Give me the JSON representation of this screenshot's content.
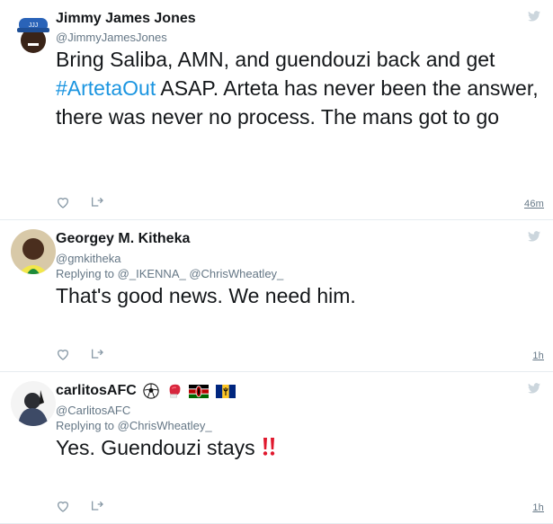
{
  "tweets": [
    {
      "name": "Jimmy James Jones",
      "handle": "@JimmyJamesJones",
      "text_before": "Bring Saliba, AMN, and guendouzi back and get ",
      "hashtag": "#ArtetaOut",
      "text_after": " ASAP. Arteta has never been the answer, there was never no process. The mans got to go",
      "time": "46m",
      "avatar_icon": "avatar-cap-icon"
    },
    {
      "name": "Georgey M. Kitheka",
      "handle": "@gmkitheka",
      "reply_prefix": "Replying to ",
      "reply_users": "@_IKENNA_ @ChrisWheatley_",
      "text": "That's good news. We need him.",
      "time": "1h",
      "avatar_icon": "avatar-photo-icon"
    },
    {
      "name": "carlitosAFC",
      "handle": "@CarlitosAFC",
      "reply_prefix": "Replying to ",
      "reply_users": "@ChrisWheatley_",
      "text": "Yes. Guendouzi stays ",
      "emoji_after_text": "double-exclamation-icon",
      "name_emojis": [
        "soccer-ball-icon",
        "boxing-glove-icon",
        "kenya-flag-icon",
        "barbados-flag-icon"
      ],
      "time": "1h",
      "avatar_icon": "avatar-photo-icon"
    }
  ],
  "colors": {
    "text": "#14171a",
    "secondary": "#657786",
    "link": "#1b95e0",
    "divider": "#e6ecf0",
    "bird": "#ccd6dd"
  }
}
